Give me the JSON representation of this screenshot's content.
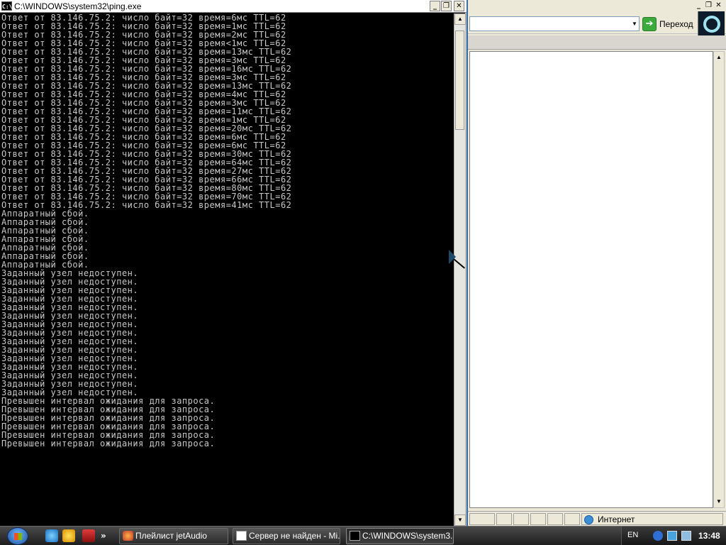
{
  "console": {
    "title": "C:\\WINDOWS\\system32\\ping.exe",
    "title_icon": "C:\\",
    "controls": {
      "minimize": "_",
      "maximize": "❐",
      "close": "✕"
    },
    "lines": [
      "Ответ от 83.146.75.2: число байт=32 время=6мс TTL=62",
      "Ответ от 83.146.75.2: число байт=32 время=1мс TTL=62",
      "Ответ от 83.146.75.2: число байт=32 время=2мс TTL=62",
      "Ответ от 83.146.75.2: число байт=32 время<1мс TTL=62",
      "Ответ от 83.146.75.2: число байт=32 время=13мс TTL=62",
      "Ответ от 83.146.75.2: число байт=32 время=3мс TTL=62",
      "Ответ от 83.146.75.2: число байт=32 время=16мс TTL=62",
      "Ответ от 83.146.75.2: число байт=32 время=3мс TTL=62",
      "Ответ от 83.146.75.2: число байт=32 время=13мс TTL=62",
      "Ответ от 83.146.75.2: число байт=32 время=4мс TTL=62",
      "Ответ от 83.146.75.2: число байт=32 время=3мс TTL=62",
      "Ответ от 83.146.75.2: число байт=32 время=11мс TTL=62",
      "Ответ от 83.146.75.2: число байт=32 время=1мс TTL=62",
      "Ответ от 83.146.75.2: число байт=32 время=20мс TTL=62",
      "Ответ от 83.146.75.2: число байт=32 время=6мс TTL=62",
      "Ответ от 83.146.75.2: число байт=32 время=6мс TTL=62",
      "Ответ от 83.146.75.2: число байт=32 время=30мс TTL=62",
      "Ответ от 83.146.75.2: число байт=32 время=64мс TTL=62",
      "Ответ от 83.146.75.2: число байт=32 время=27мс TTL=62",
      "Ответ от 83.146.75.2: число байт=32 время=66мс TTL=62",
      "Ответ от 83.146.75.2: число байт=32 время=80мс TTL=62",
      "Ответ от 83.146.75.2: число байт=32 время=70мс TTL=62",
      "Ответ от 83.146.75.2: число байт=32 время=41мс TTL=62",
      "Аппаратный сбой.",
      "Аппаратный сбой.",
      "Аппаратный сбой.",
      "Аппаратный сбой.",
      "Аппаратный сбой.",
      "Аппаратный сбой.",
      "Аппаратный сбой.",
      "Заданный узел недоступен.",
      "Заданный узел недоступен.",
      "Заданный узел недоступен.",
      "Заданный узел недоступен.",
      "Заданный узел недоступен.",
      "Заданный узел недоступен.",
      "Заданный узел недоступен.",
      "Заданный узел недоступен.",
      "Заданный узел недоступен.",
      "Заданный узел недоступен.",
      "Заданный узел недоступен.",
      "Заданный узел недоступен.",
      "Заданный узел недоступен.",
      "Заданный узел недоступен.",
      "Заданный узел недоступен.",
      "Превышен интервал ожидания для запроса.",
      "Превышен интервал ожидания для запроса.",
      "Превышен интервал ожидания для запроса.",
      "Превышен интервал ожидания для запроса.",
      "Превышен интервал ожидания для запроса.",
      "Превышен интервал ожидания для запроса."
    ],
    "scroll_up": "▲",
    "scroll_down": "▼"
  },
  "browser": {
    "controls": {
      "minimize": "_",
      "maximize": "❐",
      "close": "✕"
    },
    "address_dropdown": "▼",
    "go_arrow": "➔",
    "go_label": "Переход",
    "scroll_up": "▲",
    "scroll_down": "▼",
    "status_zone": "Интернет"
  },
  "taskbar": {
    "tasks": [
      {
        "label": "Плейлист jetAudio",
        "icon": "jetaudio-icon"
      },
      {
        "label": "Сервер не найден - Mi...",
        "icon": "ie-icon"
      },
      {
        "label": "C:\\WINDOWS\\system3...",
        "icon": "console-icon"
      }
    ],
    "quicklaunch_more": "»",
    "language": "EN",
    "clock": "13:48"
  }
}
